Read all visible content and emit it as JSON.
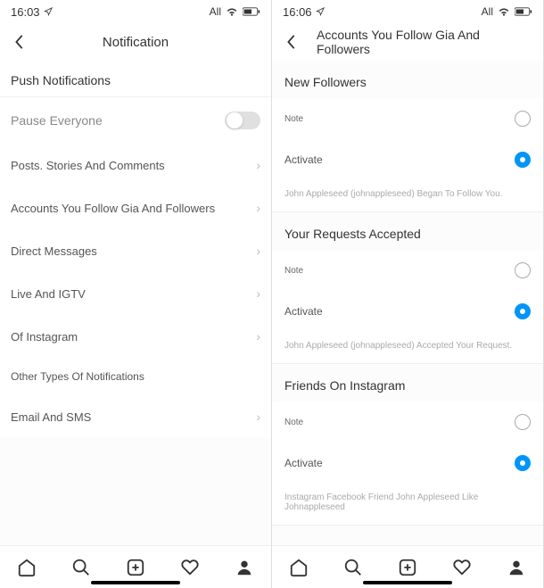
{
  "left": {
    "status": {
      "time": "16:03",
      "indicator": "All"
    },
    "header": {
      "title": "Notification"
    },
    "push_label": "Push Notifications",
    "pause_label": "Pause Everyone",
    "items": {
      "posts": "Posts. Stories And Comments",
      "accounts": "Accounts You Follow Gia And Followers",
      "dm": "Direct Messages",
      "live": "Live And IGTV",
      "ofig": "Of Instagram",
      "other": "Other Types Of Notifications",
      "email": "Email And SMS"
    }
  },
  "right": {
    "status": {
      "time": "16:06",
      "indicator": "All"
    },
    "header": {
      "title": "Accounts You Follow Gia And Followers"
    },
    "sections": {
      "new_followers": {
        "title": "New Followers",
        "none": "Note",
        "activate": "Activate",
        "hint": "John Appleseed (johnappleseed) Began To Follow You."
      },
      "requests": {
        "title": "Your Requests Accepted",
        "none": "Note",
        "activate": "Activate",
        "hint": "John Appleseed (johnappleseed) Accepted Your Request."
      },
      "friends": {
        "title": "Friends On Instagram",
        "none": "Note",
        "activate": "Activate",
        "hint": "Instagram Facebook Friend John Appleseed Like Johnappleseed"
      }
    }
  }
}
